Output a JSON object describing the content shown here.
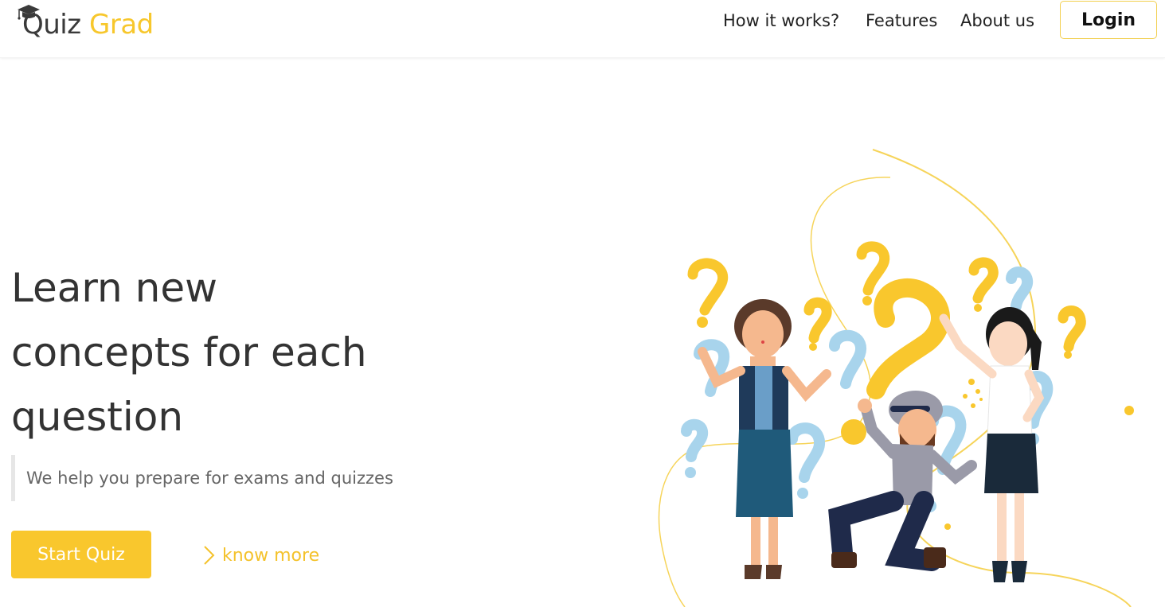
{
  "nav": {
    "logo_part1": "Quiz",
    "logo_part2": "Grad",
    "links": [
      "How it works?",
      "Features",
      "About us"
    ],
    "login_label": "Login"
  },
  "hero": {
    "title_line1": "Learn new",
    "title_line2": "concepts for each",
    "title_line3": "question",
    "subtitle": "We help you prepare for exams and quizzes",
    "start_label": "Start Quiz",
    "know_more_label": "know more"
  },
  "colors": {
    "accent": "#f9c72d",
    "text": "#333333",
    "muted": "#666666",
    "question_blue": "#a8d4ec"
  },
  "icons": {
    "logo_cap": "graduation-cap-icon",
    "know_more": "chevron-right-icon"
  }
}
